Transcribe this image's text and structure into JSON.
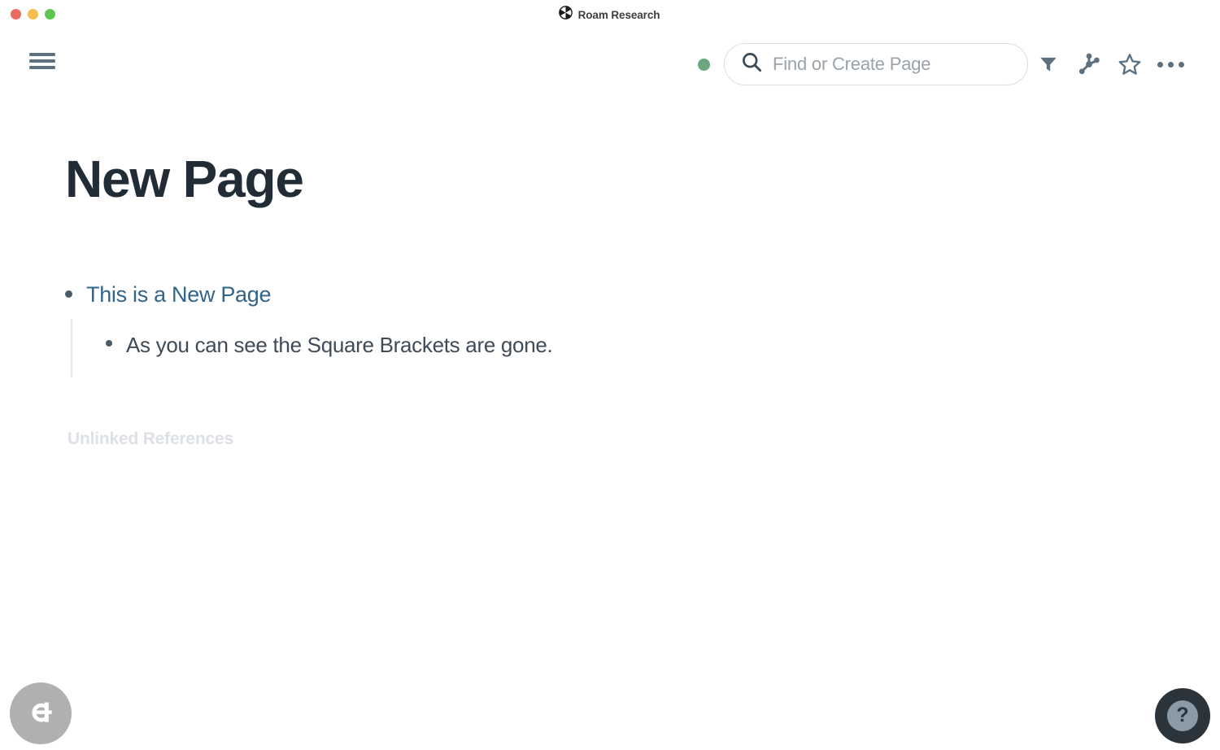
{
  "window": {
    "title": "Roam Research",
    "logo_icon": "roam-logo-icon",
    "traffic_lights": [
      {
        "name": "close",
        "color": "#ED6A5E"
      },
      {
        "name": "minimize",
        "color": "#F5BD4F"
      },
      {
        "name": "maximize",
        "color": "#61C554"
      }
    ]
  },
  "header": {
    "menu_icon": "hamburger-menu-icon",
    "status_dot": {
      "icon": "status-dot-icon",
      "color": "#6aa77f"
    },
    "search": {
      "icon": "search-icon",
      "value": "",
      "placeholder": "Find or Create Page"
    },
    "actions": [
      {
        "icon": "filter-icon",
        "label": "Filter"
      },
      {
        "icon": "graph-overview-icon",
        "label": "Graph Overview"
      },
      {
        "icon": "star-icon",
        "label": "Star"
      },
      {
        "icon": "more-options-icon",
        "label": "More Options"
      }
    ]
  },
  "main": {
    "page_title": "New Page",
    "blocks": [
      {
        "text": "This is a New Page",
        "type": "page-reference",
        "children": [
          {
            "text": "As you can see the Square Brackets are gone.",
            "type": "text"
          }
        ]
      }
    ],
    "unlinked_references_label": "Unlinked References"
  },
  "floating": {
    "left_button": {
      "icon": "roam-mark-icon",
      "label": ""
    },
    "help_button": {
      "icon": "help-icon",
      "label": "?"
    }
  },
  "colors": {
    "page_link": "#31658c",
    "title": "#222c36",
    "body_text": "#3f4b57",
    "muted": "#dde1e6",
    "icon": "#5c7080"
  }
}
